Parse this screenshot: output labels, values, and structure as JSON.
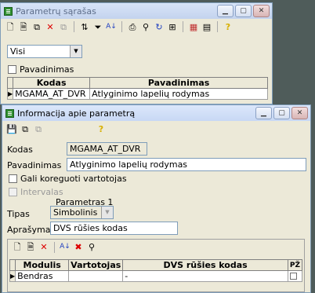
{
  "param_list_window": {
    "title": "Parametrų sąrašas",
    "filter_value": "Visi",
    "name_checkbox_label": "Pavadinimas",
    "columns": [
      "Kodas",
      "Pavadinimas"
    ],
    "rows": [
      {
        "code": "MGAMA_AT_DVR",
        "name": "Atlyginimo lapelių rodymas"
      }
    ]
  },
  "info_window": {
    "title": "Informacija apie parametrą",
    "code_label": "Kodas",
    "code_value": "MGAMA_AT_DVR",
    "name_label": "Pavadinimas",
    "name_value": "Atlyginimo lapelių rodymas",
    "user_edit_label": "Gali koreguoti vartotojas",
    "intervals_label": "Intervalas",
    "param_group_label": "Parametras 1",
    "type_label": "Tipas",
    "type_value": "Simbolinis",
    "desc_label": "Aprašymas",
    "desc_value": "DVS rūšies kodas",
    "grid_columns": [
      "Modulis",
      "Vartotojas",
      "DVS rūšies kodas",
      "PŽ"
    ],
    "grid_rows": [
      {
        "module": "Bendras",
        "user": "",
        "dvs": "-"
      }
    ]
  }
}
